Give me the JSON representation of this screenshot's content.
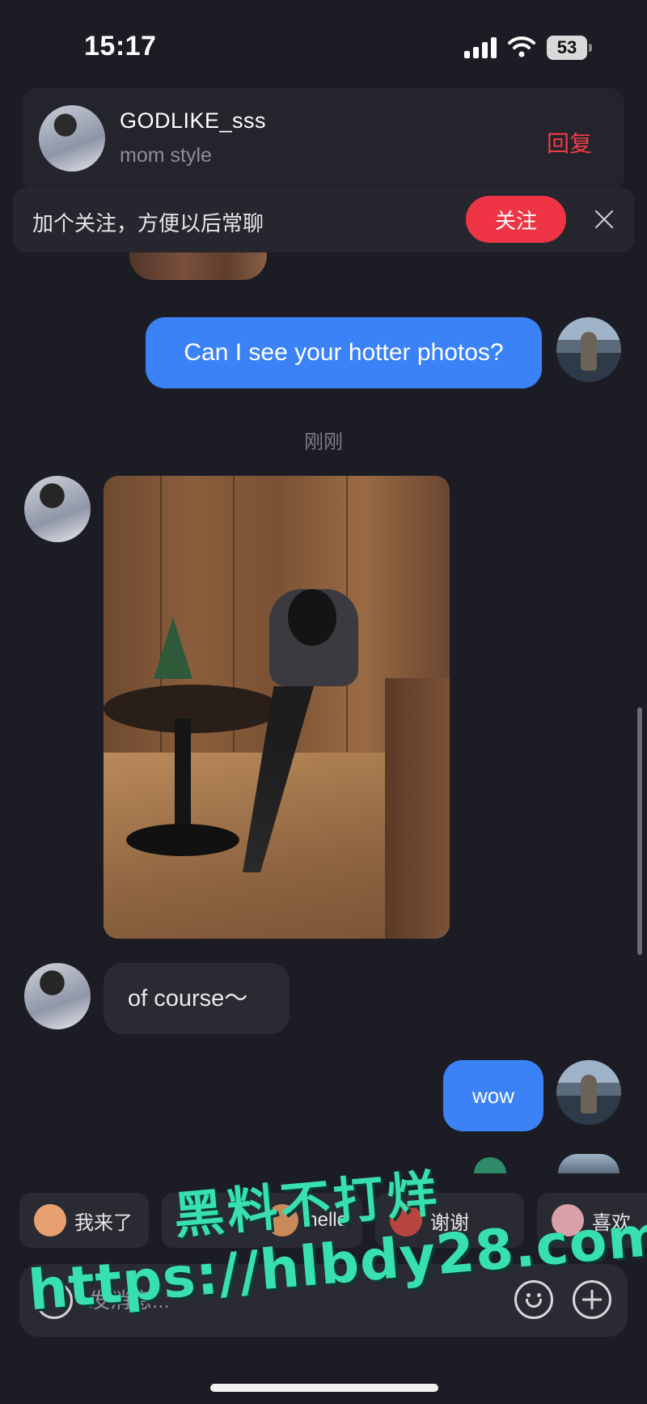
{
  "status_bar": {
    "time": "15:17",
    "battery": "53"
  },
  "notification": {
    "username": "GODLIKE_sss",
    "subtitle": "mom style",
    "reply_label": "回复"
  },
  "follow_bar": {
    "prompt": "加个关注，方便以后常聊",
    "follow_label": "关注"
  },
  "messages": {
    "out_1": "Can I see your hotter photos?",
    "timestamp": "刚刚",
    "in_1": "of course～",
    "out_2": "wow"
  },
  "quick_replies": [
    {
      "label": "我来了"
    },
    {
      "label": "hello"
    },
    {
      "label": "谢谢"
    },
    {
      "label": "喜欢"
    }
  ],
  "input": {
    "placeholder": "发消息..."
  },
  "watermark": {
    "line1": "黑料不打烊",
    "line2": "https://hlbdy28.com"
  },
  "colors": {
    "accent_red": "#ef3545",
    "bubble_blue": "#3b82f6",
    "background": "#1c1c24",
    "watermark": "#38e0b0"
  }
}
